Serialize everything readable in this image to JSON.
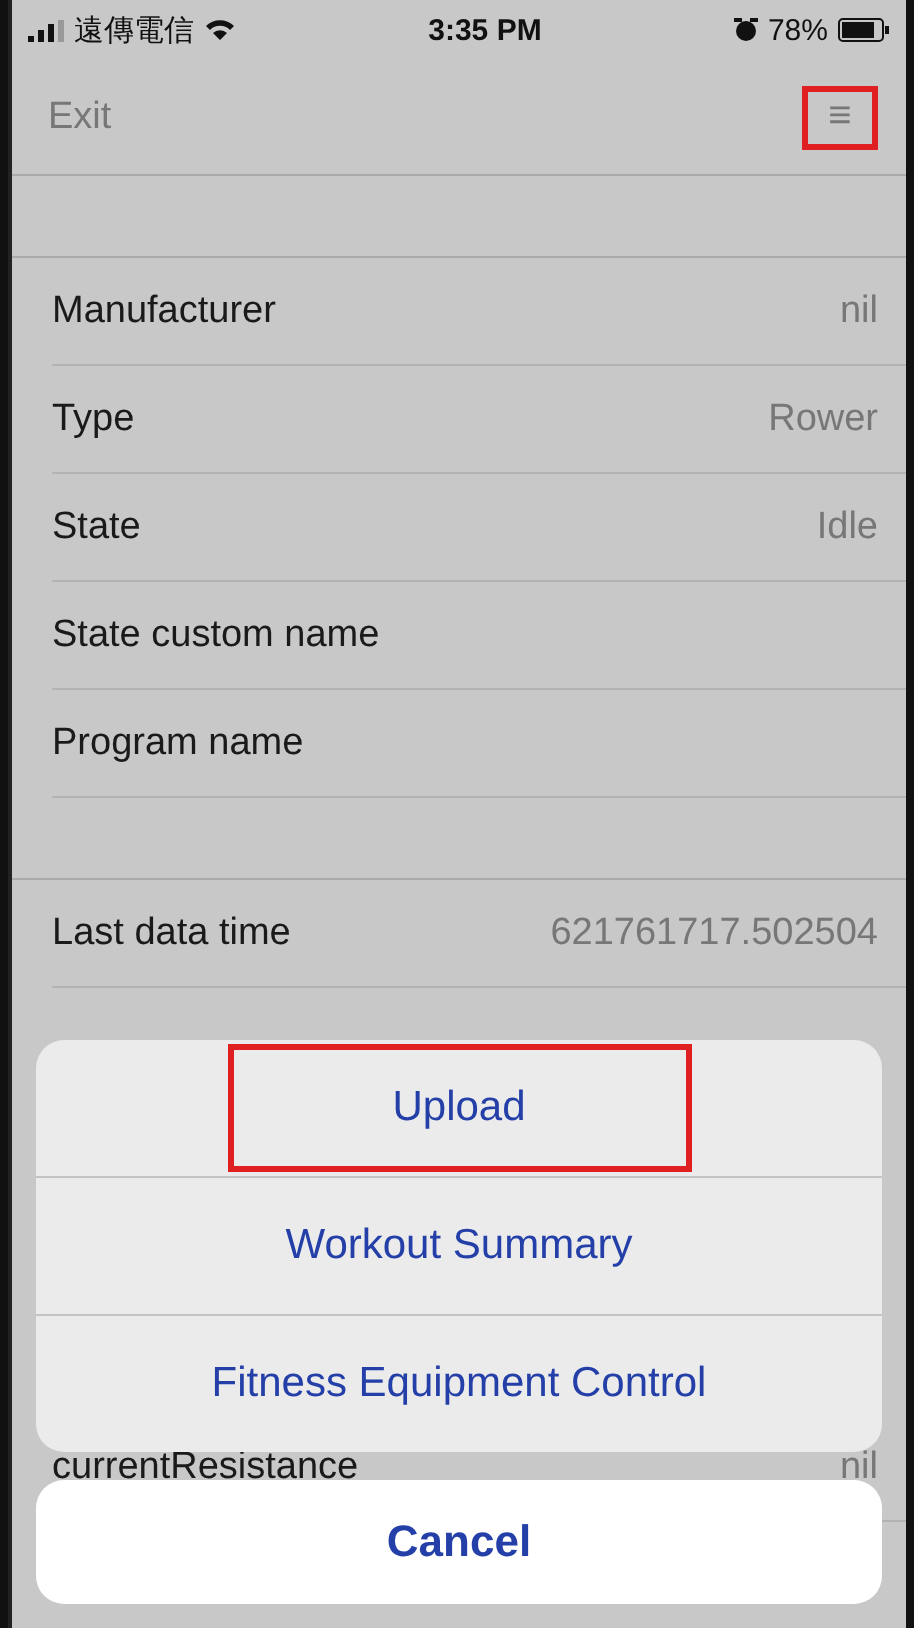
{
  "status_bar": {
    "carrier": "遠傳電信",
    "time": "3:35 PM",
    "battery": "78%"
  },
  "nav": {
    "back": "Exit",
    "menu": {
      "label": "≡",
      "highlighted": true
    }
  },
  "info_rows": [
    {
      "label": "Manufacturer",
      "value": "nil"
    },
    {
      "label": "Type",
      "value": "Rower"
    },
    {
      "label": "State",
      "value": "Idle"
    },
    {
      "label": "State custom name"
    },
    {
      "label": "Program name"
    }
  ],
  "data_rows": [
    {
      "label": "Last data time",
      "value": "621761717.502504"
    }
  ],
  "covered_row": {
    "label": "currentResistance",
    "value": "nil"
  },
  "action_sheet": {
    "actions": [
      {
        "label": "Upload",
        "highlighted": true
      },
      {
        "label": "Workout Summary",
        "highlighted": false
      },
      {
        "label": "Fitness Equipment Control",
        "highlighted": false
      }
    ],
    "cancel": "Cancel"
  }
}
